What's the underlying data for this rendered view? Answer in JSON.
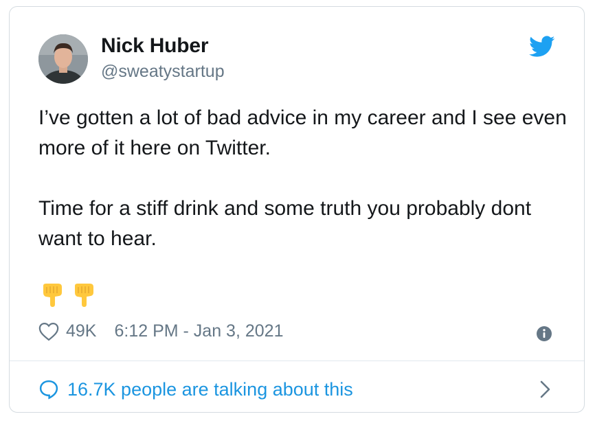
{
  "author": {
    "name": "Nick Huber",
    "handle": "@sweatystartup"
  },
  "tweet": {
    "paragraphs": [
      "I’ve gotten a lot of bad advice in my career and I see even more of it here on Twitter.",
      "Time for a stiff drink and some truth you probably dont want to hear."
    ],
    "emojis": [
      "backhand-index-pointing-down",
      "backhand-index-pointing-down"
    ]
  },
  "meta": {
    "likes": "49K",
    "timestamp": "6:12 PM - Jan 3, 2021"
  },
  "footer": {
    "conversation_text": "16.7K people are talking about this"
  },
  "colors": {
    "accent": "#1b95e0",
    "twitter_blue": "#1da1f2",
    "secondary_text": "#657786",
    "primary_text": "#14171a",
    "emoji_yellow": "#ffc83d"
  },
  "icons": {
    "brand": "twitter-bird-icon",
    "like": "heart-icon",
    "info": "info-icon",
    "conversation": "speech-bubble-icon",
    "expand": "chevron-right-icon"
  }
}
